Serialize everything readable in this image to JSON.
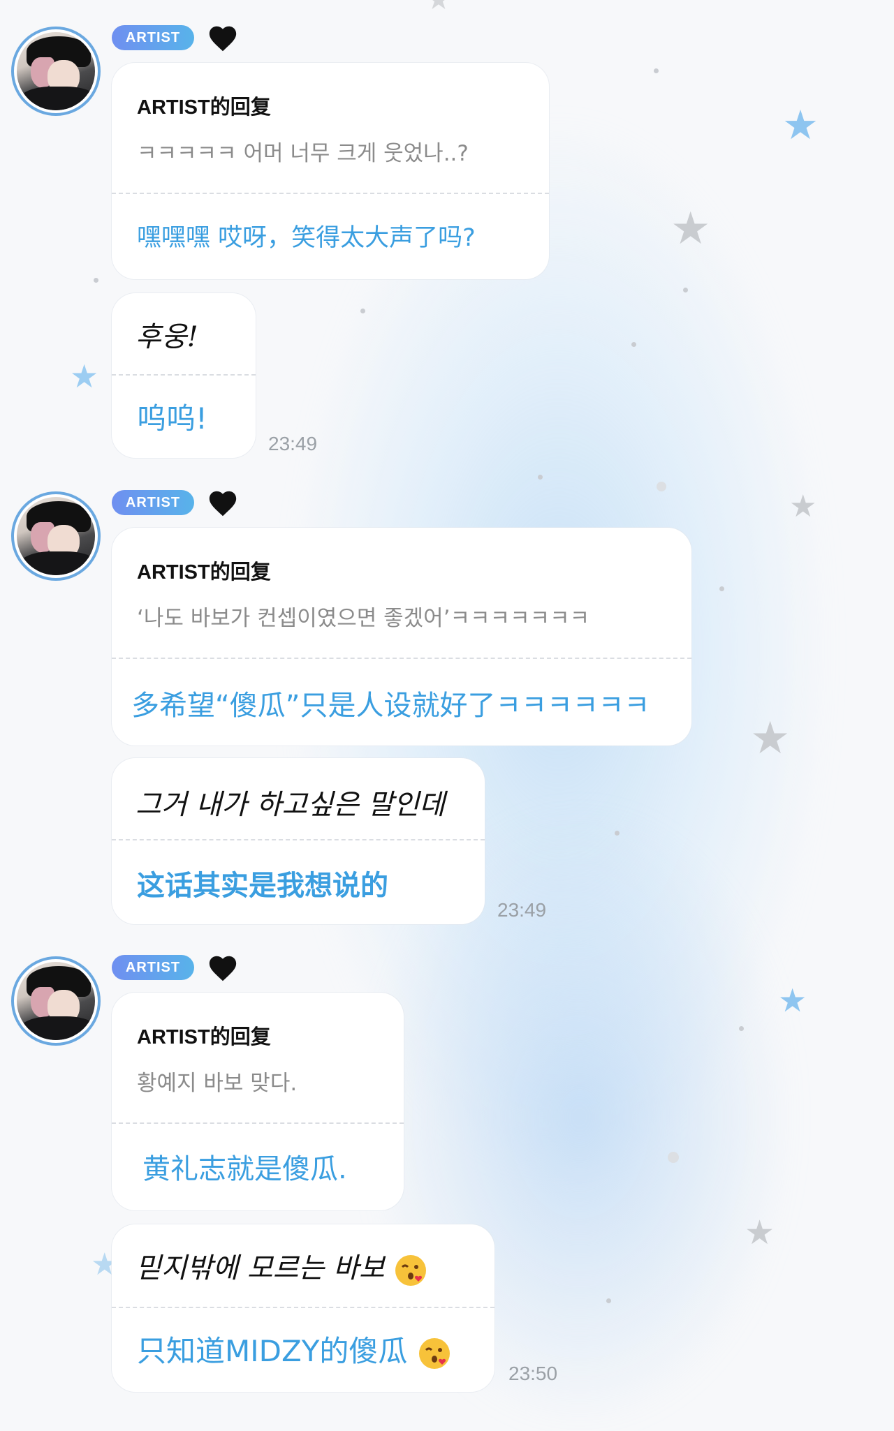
{
  "colors": {
    "accent_blue": "#3a9ee0",
    "tag_gradient_start": "#6f8ff0",
    "tag_gradient_end": "#58b3ea",
    "avatar_ring": "#6aa8e0",
    "timestamp_gray": "#9aa0a6",
    "original_text_gray": "#8b8b8b"
  },
  "messages": [
    {
      "badge": "ARTIST",
      "heart_icon": "black-heart-icon",
      "reply": {
        "title": "ARTIST的回复",
        "original": "ㅋㅋㅋㅋㅋ 어머 너무 크게 웃었나..?",
        "translation": "嘿嘿嘿 哎呀，笑得太大声了吗?"
      },
      "follow": {
        "text": "후웅!",
        "translation": "呜呜!"
      },
      "time": "23:49"
    },
    {
      "badge": "ARTIST",
      "heart_icon": "black-heart-icon",
      "reply": {
        "title": "ARTIST的回复",
        "original": "‘나도 바보가 컨셉이였으면 좋겠어’ㅋㅋㅋㅋㅋㅋㅋ",
        "translation": "多希望“傻瓜”只是人设就好了ㅋㅋㅋㅋㅋㅋ"
      },
      "follow": {
        "text": "그거 내가 하고싶은 말인데",
        "translation": "这话其实是我想说的"
      },
      "time": "23:49"
    },
    {
      "badge": "ARTIST",
      "heart_icon": "black-heart-icon",
      "reply": {
        "title": "ARTIST的回复",
        "original": "황예지 바보 맞다.",
        "translation": "黄礼志就是傻瓜."
      },
      "follow": {
        "text": "믿지밖에 모르는 바보",
        "translation": "只知道MIDZY的傻瓜"
      },
      "time": "23:50"
    }
  ]
}
